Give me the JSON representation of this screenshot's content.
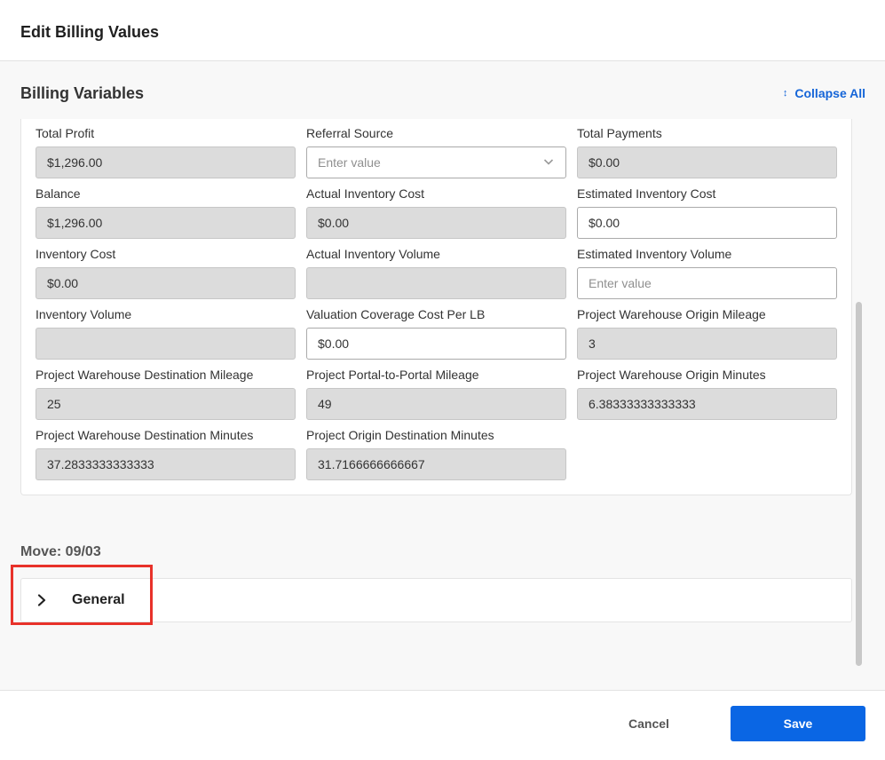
{
  "header": {
    "title": "Edit Billing Values"
  },
  "section": {
    "title": "Billing Variables",
    "collapse_all_label": "Collapse All",
    "collapse_icon": "collapse-arrows-icon"
  },
  "fields": [
    {
      "label": "Total Profit",
      "value": "$1,296.00",
      "editable": false
    },
    {
      "label": "Referral Source",
      "value": "",
      "placeholder": "Enter value",
      "editable": true,
      "type": "select"
    },
    {
      "label": "Total Payments",
      "value": "$0.00",
      "editable": false
    },
    {
      "label": "Balance",
      "value": "$1,296.00",
      "editable": false
    },
    {
      "label": "Actual Inventory Cost",
      "value": "$0.00",
      "editable": false
    },
    {
      "label": "Estimated Inventory Cost",
      "value": "$0.00",
      "editable": true
    },
    {
      "label": "Inventory Cost",
      "value": "$0.00",
      "editable": false
    },
    {
      "label": "Actual Inventory Volume",
      "value": "",
      "editable": false
    },
    {
      "label": "Estimated Inventory Volume",
      "value": "",
      "placeholder": "Enter value",
      "editable": true
    },
    {
      "label": "Inventory Volume",
      "value": "",
      "editable": false
    },
    {
      "label": "Valuation Coverage Cost Per LB",
      "value": "$0.00",
      "editable": true
    },
    {
      "label": "Project Warehouse Origin Mileage",
      "value": "3",
      "editable": false
    },
    {
      "label": "Project Warehouse Destination Mileage",
      "value": "25",
      "editable": false
    },
    {
      "label": "Project Portal-to-Portal Mileage",
      "value": "49",
      "editable": false
    },
    {
      "label": "Project Warehouse Origin Minutes",
      "value": "6.38333333333333",
      "editable": false
    },
    {
      "label": "Project Warehouse Destination Minutes",
      "value": "37.2833333333333",
      "editable": false
    },
    {
      "label": "Project Origin Destination Minutes",
      "value": "31.7166666666667",
      "editable": false
    }
  ],
  "move": {
    "title": "Move: 09/03",
    "accordion": {
      "label": "General",
      "icon": "chevron-right-icon",
      "expanded": false
    }
  },
  "footer": {
    "cancel_label": "Cancel",
    "save_label": "Save"
  },
  "colors": {
    "accent": "#0a66e4",
    "link": "#1565d8",
    "highlight": "#e8322a",
    "readonly_bg": "#dcdcdc"
  }
}
